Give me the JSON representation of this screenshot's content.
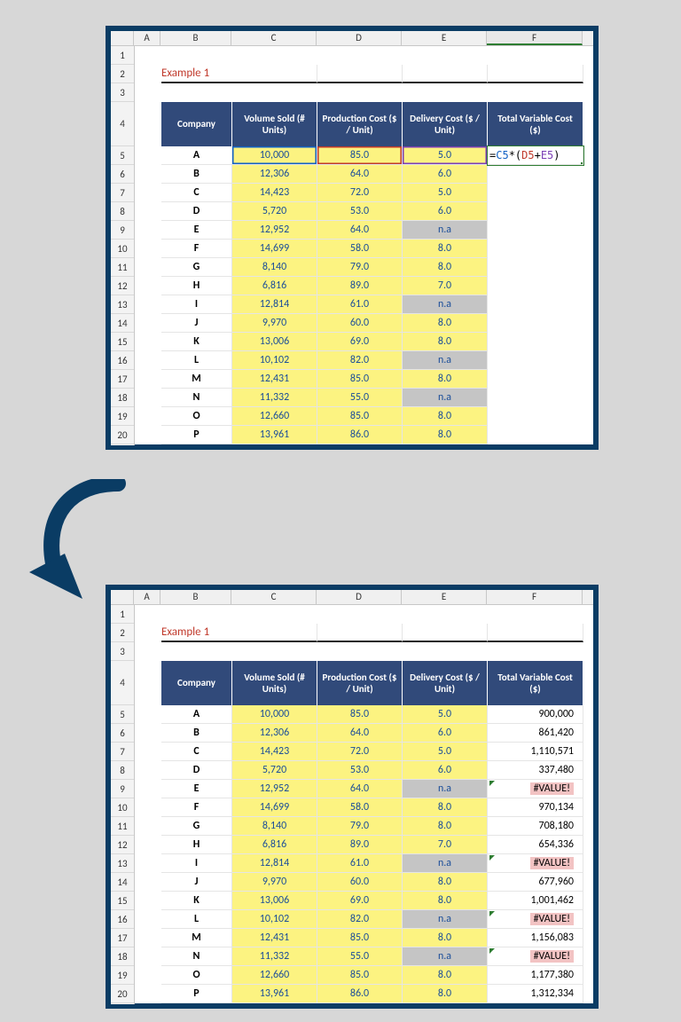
{
  "example_label": "Example 1",
  "columns": [
    "A",
    "B",
    "C",
    "D",
    "E",
    "F"
  ],
  "rowcount": 20,
  "headers": {
    "company": "Company",
    "volume": "Volume Sold (# Units)",
    "prod": "Production Cost ($ / Unit)",
    "deliv": "Delivery Cost ($ / Unit)",
    "total": "Total Variable Cost ($)"
  },
  "chart_data": {
    "type": "table",
    "title": "Example 1",
    "columns": [
      "Company",
      "Volume Sold (# Units)",
      "Production Cost ($ / Unit)",
      "Delivery Cost ($ / Unit)",
      "Total Variable Cost ($)"
    ],
    "rows": [
      {
        "company": "A",
        "volume": "10,000",
        "prod": "85.0",
        "deliv": "5.0",
        "total": "900,000"
      },
      {
        "company": "B",
        "volume": "12,306",
        "prod": "64.0",
        "deliv": "6.0",
        "total": "861,420"
      },
      {
        "company": "C",
        "volume": "14,423",
        "prod": "72.0",
        "deliv": "5.0",
        "total": "1,110,571"
      },
      {
        "company": "D",
        "volume": "5,720",
        "prod": "53.0",
        "deliv": "6.0",
        "total": "337,480"
      },
      {
        "company": "E",
        "volume": "12,952",
        "prod": "64.0",
        "deliv": "n.a",
        "total": "#VALUE!"
      },
      {
        "company": "F",
        "volume": "14,699",
        "prod": "58.0",
        "deliv": "8.0",
        "total": "970,134"
      },
      {
        "company": "G",
        "volume": "8,140",
        "prod": "79.0",
        "deliv": "8.0",
        "total": "708,180"
      },
      {
        "company": "H",
        "volume": "6,816",
        "prod": "89.0",
        "deliv": "7.0",
        "total": "654,336"
      },
      {
        "company": "I",
        "volume": "12,814",
        "prod": "61.0",
        "deliv": "n.a",
        "total": "#VALUE!"
      },
      {
        "company": "J",
        "volume": "9,970",
        "prod": "60.0",
        "deliv": "8.0",
        "total": "677,960"
      },
      {
        "company": "K",
        "volume": "13,006",
        "prod": "69.0",
        "deliv": "8.0",
        "total": "1,001,462"
      },
      {
        "company": "L",
        "volume": "10,102",
        "prod": "82.0",
        "deliv": "n.a",
        "total": "#VALUE!"
      },
      {
        "company": "M",
        "volume": "12,431",
        "prod": "85.0",
        "deliv": "8.0",
        "total": "1,156,083"
      },
      {
        "company": "N",
        "volume": "11,332",
        "prod": "55.0",
        "deliv": "n.a",
        "total": "#VALUE!"
      },
      {
        "company": "O",
        "volume": "12,660",
        "prod": "85.0",
        "deliv": "8.0",
        "total": "1,177,380"
      },
      {
        "company": "P",
        "volume": "13,961",
        "prod": "86.0",
        "deliv": "8.0",
        "total": "1,312,334"
      }
    ]
  },
  "formula": {
    "prefix": "=",
    "c_ref": "C5",
    "op1": "*(",
    "d_ref": "D5",
    "op2": "+",
    "e_ref": "E5",
    "suffix": ")"
  }
}
